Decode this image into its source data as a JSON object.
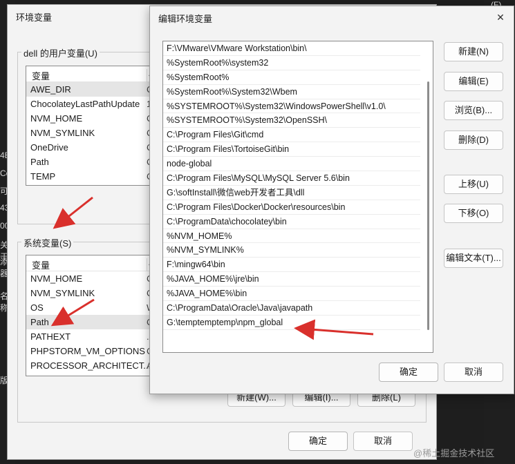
{
  "background": {
    "left_glyphs": [
      "4B",
      "Co",
      "可",
      "43",
      "00",
      "关于",
      "添器",
      "名称",
      "版"
    ],
    "right_glyph": "(F)"
  },
  "env_dialog": {
    "title": "环境变量",
    "user_group": {
      "label": "dell 的用户变量(U)",
      "columns": [
        "变量",
        "值"
      ],
      "rows": [
        {
          "name": "AWE_DIR",
          "value": "C",
          "selected": true
        },
        {
          "name": "ChocolateyLastPathUpdate",
          "value": "1"
        },
        {
          "name": "NVM_HOME",
          "value": "C"
        },
        {
          "name": "NVM_SYMLINK",
          "value": "C"
        },
        {
          "name": "OneDrive",
          "value": "C"
        },
        {
          "name": "Path",
          "value": "C"
        },
        {
          "name": "TEMP",
          "value": "C"
        }
      ]
    },
    "system_group": {
      "label": "系统变量(S)",
      "columns": [
        "变量",
        "值"
      ],
      "rows": [
        {
          "name": "NVM_HOME",
          "value": "C"
        },
        {
          "name": "NVM_SYMLINK",
          "value": "C"
        },
        {
          "name": "OS",
          "value": "W"
        },
        {
          "name": "Path",
          "value": "C",
          "selected": true
        },
        {
          "name": "PATHEXT",
          "value": "."
        },
        {
          "name": "PHPSTORM_VM_OPTIONS",
          "value": "C"
        },
        {
          "name": "PROCESSOR_ARCHITECT...",
          "value": "A"
        }
      ],
      "buttons": {
        "new": "新建(W)...",
        "edit": "编辑(I)...",
        "delete": "删除(L)"
      }
    },
    "ok": "确定",
    "cancel": "取消"
  },
  "edit_dialog": {
    "title": "编辑环境变量",
    "paths": [
      "F:\\VMware\\VMware Workstation\\bin\\",
      "%SystemRoot%\\system32",
      "%SystemRoot%",
      "%SystemRoot%\\System32\\Wbem",
      "%SYSTEMROOT%\\System32\\WindowsPowerShell\\v1.0\\",
      "%SYSTEMROOT%\\System32\\OpenSSH\\",
      "C:\\Program Files\\Git\\cmd",
      "C:\\Program Files\\TortoiseGit\\bin",
      "node-global",
      "C:\\Program Files\\MySQL\\MySQL Server 5.6\\bin",
      "G:\\softInstall\\微信web开发者工具\\dll",
      "C:\\Program Files\\Docker\\Docker\\resources\\bin",
      "C:\\ProgramData\\chocolatey\\bin",
      "%NVM_HOME%",
      "%NVM_SYMLINK%",
      "F:\\mingw64\\bin",
      "%JAVA_HOME%\\jre\\bin",
      "%JAVA_HOME%\\bin",
      "C:\\ProgramData\\Oracle\\Java\\javapath",
      "G:\\temptemptemp\\npm_global"
    ],
    "buttons": {
      "new": "新建(N)",
      "edit": "编辑(E)",
      "browse": "浏览(B)...",
      "delete": "删除(D)",
      "move_up": "上移(U)",
      "move_down": "下移(O)",
      "edit_text": "编辑文本(T)..."
    },
    "ok": "确定",
    "cancel": "取消",
    "close_glyph": "✕"
  },
  "watermark": "@稀土掘金技术社区",
  "colors": {
    "arrow": "#d9302c",
    "dialog_bg": "#f3f3f3",
    "selected_row": "#e5e5e5"
  }
}
